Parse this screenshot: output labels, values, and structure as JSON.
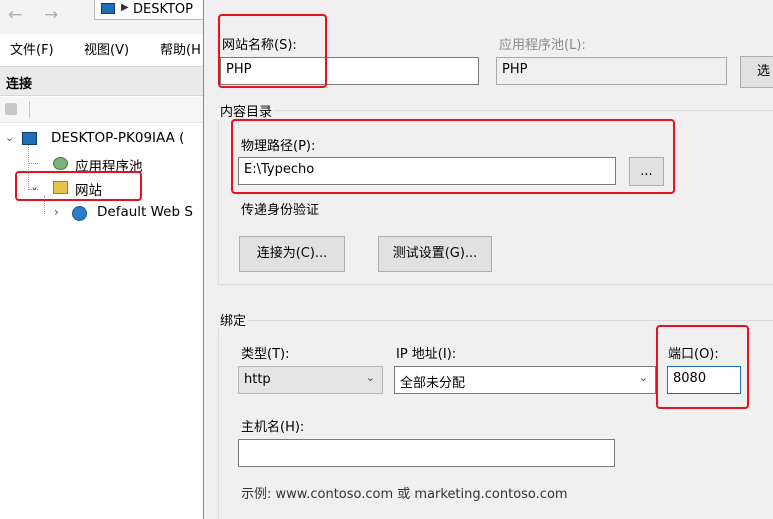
{
  "left_window": {
    "address_segment": "DESKTOP",
    "menu": [
      "文件(F)",
      "视图(V)",
      "帮助(H"
    ],
    "connections_title": "连接",
    "tree": {
      "server": "DESKTOP-PK09IAA (",
      "app_pools": "应用程序池",
      "sites": "网站",
      "default_site": "Default Web S"
    }
  },
  "dialog": {
    "site_name_label": "网站名称(S):",
    "site_name_value": "PHP",
    "app_pool_label": "应用程序池(L):",
    "app_pool_value": "PHP",
    "select_button_partial": "选",
    "content_dir": {
      "group_title": "内容目录",
      "physical_path_label": "物理路径(P):",
      "physical_path_value": "E:\\Typecho",
      "browse_label": "...",
      "pass_through_label": "传递身份验证",
      "connect_as_label": "连接为(C)...",
      "test_settings_label": "测试设置(G)..."
    },
    "binding": {
      "group_title": "绑定",
      "type_label": "类型(T):",
      "type_value": "http",
      "ip_label": "IP 地址(I):",
      "ip_value": "全部未分配",
      "port_label": "端口(O):",
      "port_value": "8080",
      "hostname_label": "主机名(H):",
      "hostname_value": "",
      "example_text": "示例: www.contoso.com 或 marketing.contoso.com"
    }
  },
  "annotation_color": "#e8121c"
}
